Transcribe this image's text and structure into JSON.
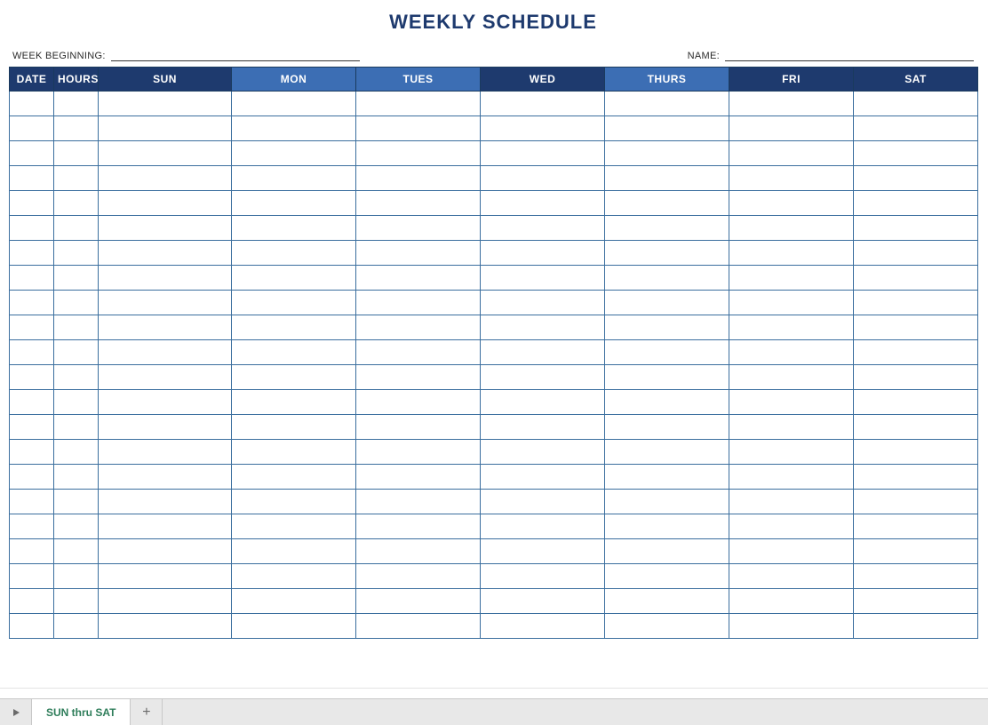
{
  "title": "WEEKLY SCHEDULE",
  "meta": {
    "week_beginning_label": "WEEK BEGINNING:",
    "week_beginning_value": "",
    "name_label": "NAME:",
    "name_value": ""
  },
  "columns": [
    {
      "key": "date",
      "label": "DATE",
      "style": "dark"
    },
    {
      "key": "hours",
      "label": "HOURS",
      "style": "dark"
    },
    {
      "key": "sun",
      "label": "SUN",
      "style": "dark"
    },
    {
      "key": "mon",
      "label": "MON",
      "style": "mid"
    },
    {
      "key": "tues",
      "label": "TUES",
      "style": "mid"
    },
    {
      "key": "wed",
      "label": "WED",
      "style": "dark"
    },
    {
      "key": "thurs",
      "label": "THURS",
      "style": "mid"
    },
    {
      "key": "fri",
      "label": "FRI",
      "style": "dark"
    },
    {
      "key": "sat",
      "label": "SAT",
      "style": "dark"
    }
  ],
  "row_count": 22,
  "sheet": {
    "active_tab": "SUN thru SAT"
  }
}
